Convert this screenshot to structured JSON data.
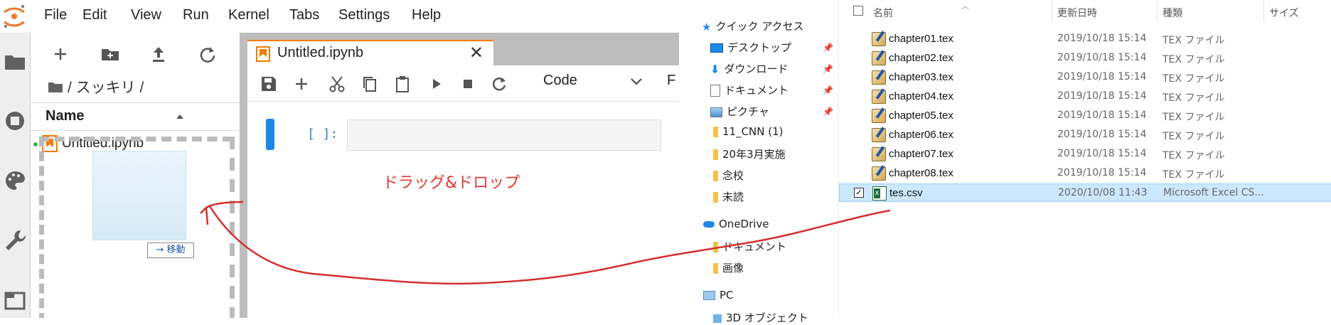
{
  "jupyter": {
    "menu": [
      "File",
      "Edit",
      "View",
      "Run",
      "Kernel",
      "Tabs",
      "Settings",
      "Help"
    ],
    "breadcrumb": "/ スッキリ /",
    "column_name": "Name",
    "file_item": "Untitled.ipynb",
    "tab_title": "Untitled.ipynb",
    "close_glyph": "✕",
    "cell_type": "Code",
    "cell_type_overflow": "F",
    "prompt": "[ ]:",
    "move_badge": "→ 移動",
    "annotation": "ドラッグ&ドロップ",
    "colors": {
      "accent": "#f57c00",
      "cell_indicator": "#1e88e5",
      "annotation": "#e53935"
    }
  },
  "explorer": {
    "nav": {
      "quick_access": "クイック アクセス",
      "desktop": "デスクトップ",
      "downloads": "ダウンロード",
      "documents": "ドキュメント",
      "pictures": "ピクチャ",
      "folders": [
        "11_CNN (1)",
        "20年3月実施",
        "念校",
        "未読"
      ],
      "onedrive": "OneDrive",
      "onedrive_docs": "ドキュメント",
      "onedrive_images": "画像",
      "pc": "PC",
      "objects3d": "3D オブジェクト"
    },
    "columns": {
      "name": "名前",
      "modified": "更新日時",
      "type": "種類",
      "size": "サイズ"
    },
    "files": [
      {
        "name": "chapter01.tex",
        "modified": "2019/10/18 15:14",
        "type": "TEX ファイル"
      },
      {
        "name": "chapter02.tex",
        "modified": "2019/10/18 15:14",
        "type": "TEX ファイル"
      },
      {
        "name": "chapter03.tex",
        "modified": "2019/10/18 15:14",
        "type": "TEX ファイル"
      },
      {
        "name": "chapter04.tex",
        "modified": "2019/10/18 15:14",
        "type": "TEX ファイル"
      },
      {
        "name": "chapter05.tex",
        "modified": "2019/10/18 15:14",
        "type": "TEX ファイル"
      },
      {
        "name": "chapter06.tex",
        "modified": "2019/10/18 15:14",
        "type": "TEX ファイル"
      },
      {
        "name": "chapter07.tex",
        "modified": "2019/10/18 15:14",
        "type": "TEX ファイル"
      },
      {
        "name": "chapter08.tex",
        "modified": "2019/10/18 15:14",
        "type": "TEX ファイル"
      },
      {
        "name": "tes.csv",
        "modified": "2020/10/08 11:43",
        "type": "Microsoft Excel CS..."
      }
    ]
  }
}
